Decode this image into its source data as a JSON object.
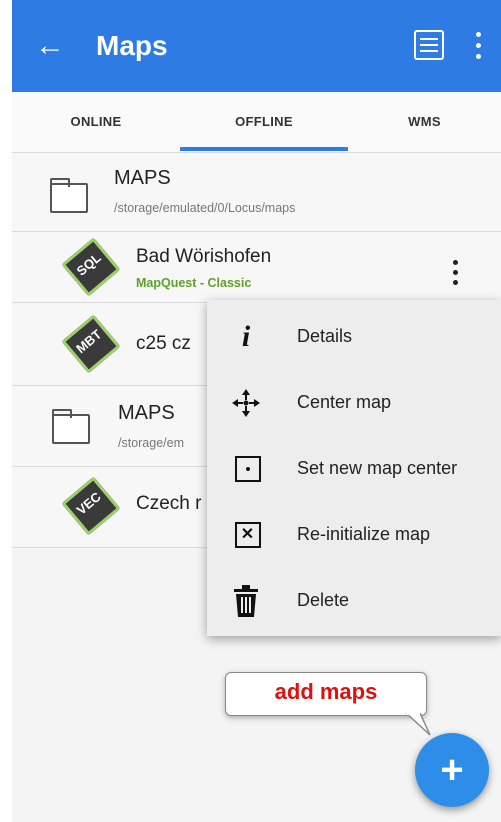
{
  "appbar": {
    "title": "Maps",
    "back_icon": "arrow-left-icon",
    "list_icon": "list-view-icon",
    "menu_icon": "more-vert-icon",
    "color": "#2d7be3"
  },
  "tabs": [
    {
      "label": "ONLINE",
      "selected": false
    },
    {
      "label": "OFFLINE",
      "selected": true
    },
    {
      "label": "WMS",
      "selected": false
    }
  ],
  "groups": [
    {
      "title": "MAPS",
      "path": "/storage/emulated/0/Locus/maps"
    },
    {
      "title": "MAPS",
      "path": "/storage/em"
    }
  ],
  "maps": [
    {
      "name": "Bad Wörishofen",
      "subtitle": "MapQuest - Classic",
      "badge": "SQL"
    },
    {
      "name": "c25 cz",
      "badge": "MBT"
    },
    {
      "name": "Czech r",
      "badge": "VEC"
    }
  ],
  "context_menu": [
    {
      "label": "Details",
      "icon": "info-icon"
    },
    {
      "label": "Center map",
      "icon": "move-arrows-icon"
    },
    {
      "label": "Set new map center",
      "icon": "center-point-icon"
    },
    {
      "label": "Re-initialize map",
      "icon": "close-box-icon"
    },
    {
      "label": "Delete",
      "icon": "trash-icon"
    }
  ],
  "callout": {
    "text": "add maps"
  },
  "fab": {
    "icon": "plus-icon",
    "label": "+"
  }
}
